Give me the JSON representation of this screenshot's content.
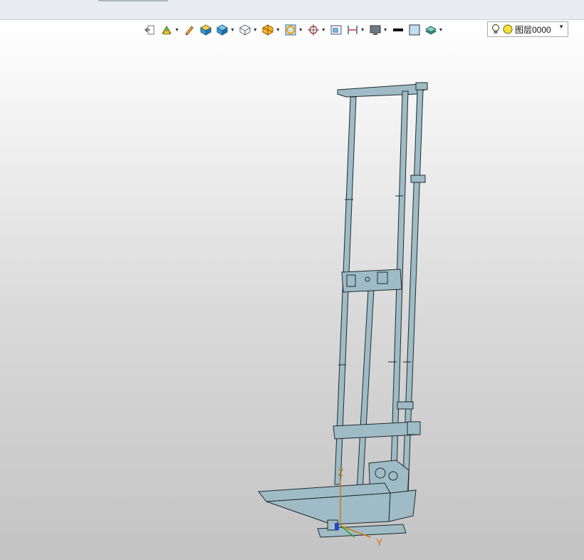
{
  "toolbar": {
    "items": [
      {
        "icon": "exit-view-icon",
        "dropdown": false
      },
      {
        "icon": "render-style-icon",
        "dropdown": true
      },
      {
        "icon": "sketch-pencil-icon",
        "dropdown": false
      },
      {
        "icon": "shaded-cube-icon",
        "dropdown": false
      },
      {
        "icon": "blue-cube-icon",
        "dropdown": true
      },
      {
        "icon": "wireframe-cube-icon",
        "dropdown": true
      },
      {
        "icon": "section-view-icon",
        "dropdown": true
      },
      {
        "icon": "ring-icon",
        "dropdown": true
      },
      {
        "icon": "orient-target-icon",
        "dropdown": true
      },
      {
        "icon": "window-fit-icon",
        "dropdown": false
      },
      {
        "icon": "dimension-icon",
        "dropdown": true
      },
      {
        "icon": "display-monitor-icon",
        "dropdown": true
      },
      {
        "icon": "line-color-icon",
        "dropdown": false
      },
      {
        "icon": "fill-color-icon",
        "dropdown": false
      },
      {
        "icon": "layer-stack-icon",
        "dropdown": true
      }
    ],
    "dropdown_glyph": "▼",
    "layer_select": {
      "value": "图层0000",
      "arrow": "▼"
    }
  },
  "model": {
    "axis_z": "Z",
    "axis_y": "Y",
    "colors": {
      "frame": "#9fbcc6",
      "edge": "#1f2a2e",
      "axis_z": "#d4780a",
      "axis_y": "#d4780a"
    }
  }
}
